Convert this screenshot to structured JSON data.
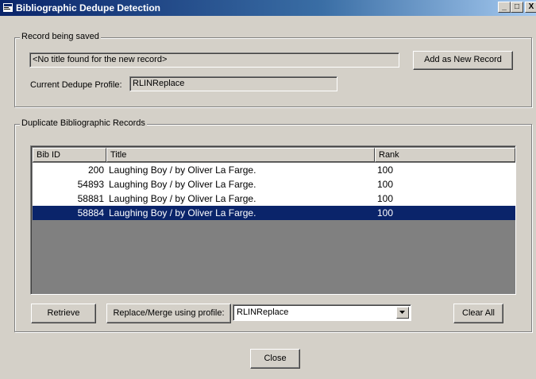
{
  "window": {
    "title": "Bibliographic Dedupe Detection"
  },
  "title_buttons": {
    "minimize": "_",
    "maximize": "□",
    "close": "X"
  },
  "record_group": {
    "label": "Record being saved",
    "title_value": "<No title found for the new record>",
    "add_button": "Add as New Record",
    "profile_label": "Current Dedupe Profile:",
    "profile_value": "RLINReplace"
  },
  "duplicates_group": {
    "label": "Duplicate Bibliographic Records",
    "columns": [
      "Bib ID",
      "Title",
      "Rank"
    ],
    "rows": [
      {
        "bib_id": "200",
        "title": "Laughing Boy / by Oliver La Farge.",
        "rank": "100"
      },
      {
        "bib_id": "54893",
        "title": "Laughing Boy / by Oliver La Farge.",
        "rank": "100"
      },
      {
        "bib_id": "58881",
        "title": "Laughing Boy / by Oliver La Farge.",
        "rank": "100"
      },
      {
        "bib_id": "58884",
        "title": "Laughing Boy / by Oliver La Farge.",
        "rank": "100"
      }
    ],
    "selected_row": 3,
    "retrieve_button": "Retrieve",
    "replace_button": "Replace/Merge using profile:",
    "profile_select": "RLINReplace",
    "clear_button": "Clear All"
  },
  "close_button": "Close",
  "colors": {
    "titlebar": "#0a246a",
    "selection": "#0a246a",
    "face": "#d4d0c8"
  }
}
